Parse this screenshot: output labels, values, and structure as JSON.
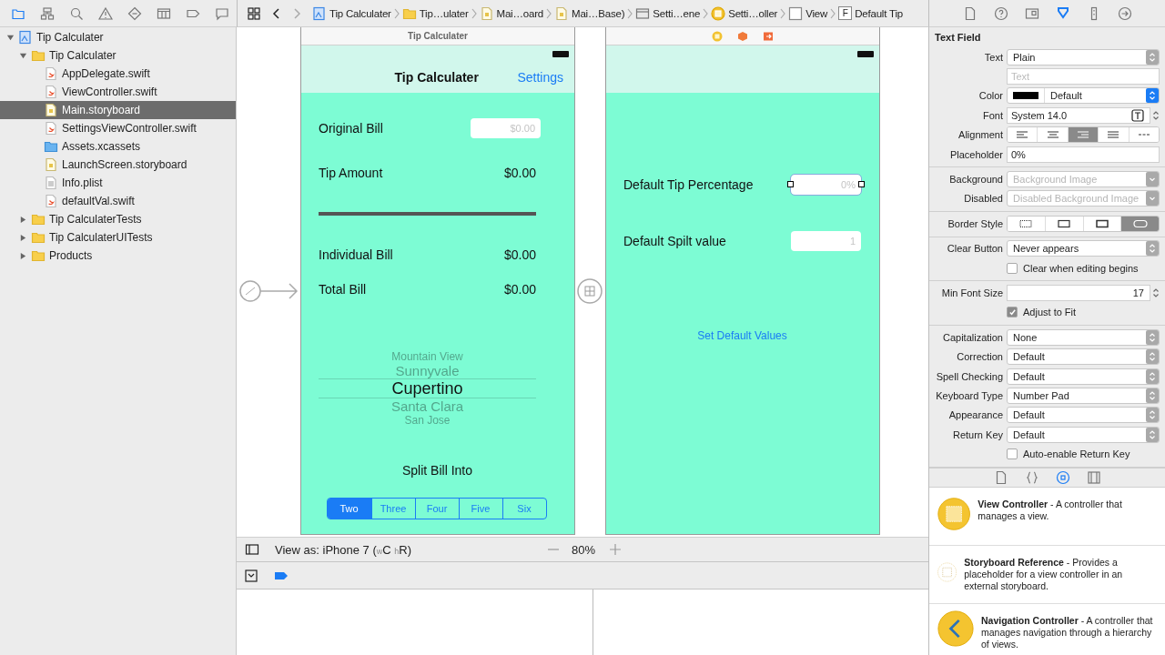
{
  "navigator_tabs": [
    {
      "selected": true
    },
    {
      "selected": false
    },
    {
      "selected": false
    },
    {
      "selected": false
    },
    {
      "selected": false
    },
    {
      "selected": false
    },
    {
      "selected": false
    },
    {
      "selected": false
    }
  ],
  "jump_bar": [
    {
      "kind": "project",
      "label": "Tip Calculater"
    },
    {
      "kind": "folder",
      "label": "Tip…ulater"
    },
    {
      "kind": "storyboard",
      "label": "Mai…oard"
    },
    {
      "kind": "storyboard",
      "label": "Mai…Base)"
    },
    {
      "kind": "scene",
      "label": "Setti…ene"
    },
    {
      "kind": "controller",
      "label": "Setti…oller"
    },
    {
      "kind": "view",
      "label": "View"
    },
    {
      "kind": "text-field",
      "badge": "F",
      "label": "Default Tip"
    }
  ],
  "inspector_tabs": [
    {
      "selected": false
    },
    {
      "selected": false
    },
    {
      "selected": false
    },
    {
      "selected": true
    },
    {
      "selected": false
    },
    {
      "selected": false
    }
  ],
  "navigator": [
    {
      "kind": "project",
      "label": "Tip Calculater",
      "expanded": true,
      "selected": false,
      "children": [
        {
          "kind": "folder",
          "label": "Tip Calculater",
          "expanded": true,
          "selected": false,
          "children": [
            {
              "kind": "swift",
              "label": "AppDelegate.swift",
              "selected": false
            },
            {
              "kind": "swift",
              "label": "ViewController.swift",
              "selected": false
            },
            {
              "kind": "storyboard",
              "label": "Main.storyboard",
              "selected": true
            },
            {
              "kind": "swift",
              "label": "SettingsViewController.swift",
              "selected": false
            },
            {
              "kind": "assets",
              "label": "Assets.xcassets",
              "selected": false
            },
            {
              "kind": "storyboard",
              "label": "LaunchScreen.storyboard",
              "selected": false
            },
            {
              "kind": "plist",
              "label": "Info.plist",
              "selected": false
            },
            {
              "kind": "swift",
              "label": "defaultVal.swift",
              "selected": false
            }
          ]
        },
        {
          "kind": "folder",
          "label": "Tip CalculaterTests",
          "expanded": false,
          "selected": false
        },
        {
          "kind": "folder",
          "label": "Tip CalculaterUITests",
          "expanded": false,
          "selected": false
        },
        {
          "kind": "folder",
          "label": "Products",
          "expanded": false,
          "selected": false
        }
      ]
    }
  ],
  "tip_scene": {
    "title": "Tip Calculater",
    "nav_title": "Tip Calculater",
    "nav_button": "Settings",
    "rows": [
      {
        "kind": "field",
        "label": "Original Bill",
        "placeholder": "$0.00"
      },
      {
        "kind": "value",
        "label": "Tip Amount",
        "value": "$0.00"
      },
      {
        "kind": "rule"
      },
      {
        "kind": "value",
        "label": "Individual Bill",
        "value": "$0.00"
      },
      {
        "kind": "value",
        "label": "Total Bill",
        "value": "$0.00"
      }
    ],
    "picker": [
      {
        "label": "Mountain View",
        "selected": false
      },
      {
        "label": "Sunnyvale",
        "selected": false
      },
      {
        "label": "Cupertino",
        "selected": true
      },
      {
        "label": "Santa Clara",
        "selected": false
      },
      {
        "label": "San Jose",
        "selected": false
      }
    ],
    "split_label": "Split Bill Into",
    "split_options": [
      {
        "label": "Two",
        "selected": true
      },
      {
        "label": "Three",
        "selected": false
      },
      {
        "label": "Four",
        "selected": false
      },
      {
        "label": "Five",
        "selected": false
      },
      {
        "label": "Six",
        "selected": false
      }
    ]
  },
  "settings_scene": {
    "rows": [
      {
        "label": "Default Tip Percentage",
        "placeholder": "0%",
        "selected": true
      },
      {
        "label": "Default Spilt value",
        "placeholder": "1",
        "selected": false
      }
    ],
    "button": "Set Default Values"
  },
  "canvas_bar": {
    "view_as": "View as: iPhone 7 ($_{w}$C $_{h}$R)",
    "zoom": "80%"
  },
  "inspector": {
    "title": "Text Field",
    "sections": [
      [
        {
          "kind": "popup",
          "label": "Text",
          "value": "Plain",
          "disabled": false
        },
        {
          "kind": "field",
          "placeholder": "Text"
        },
        {
          "kind": "color",
          "label": "Color",
          "value": "Default"
        },
        {
          "kind": "font",
          "label": "Font",
          "value": "System 14.0"
        },
        {
          "kind": "alignment",
          "label": "Alignment",
          "options": [
            {
              "selected": false
            },
            {
              "selected": false
            },
            {
              "selected": true
            },
            {
              "selected": false
            },
            {
              "selected": false
            }
          ]
        },
        {
          "kind": "field",
          "label": "Placeholder",
          "value": "0%"
        }
      ],
      [
        {
          "kind": "popup",
          "label": "Background",
          "value": "Background Image",
          "disabled": true
        },
        {
          "kind": "popup",
          "label": "Disabled",
          "value": "Disabled Background Image",
          "disabled": true
        }
      ],
      [
        {
          "kind": "border-style",
          "label": "Border Style",
          "options": [
            {
              "selected": false
            },
            {
              "selected": false
            },
            {
              "selected": false
            },
            {
              "selected": true
            }
          ]
        }
      ],
      [
        {
          "kind": "popup",
          "label": "Clear Button",
          "value": "Never appears",
          "disabled": false
        },
        {
          "kind": "checkbox",
          "label": "Clear when editing begins",
          "checked": false
        }
      ],
      [
        {
          "kind": "stepper",
          "label": "Min Font Size",
          "value": "17"
        },
        {
          "kind": "checkbox",
          "label": "Adjust to Fit",
          "checked": true
        }
      ],
      [
        {
          "kind": "popup",
          "label": "Capitalization",
          "value": "None",
          "disabled": false
        },
        {
          "kind": "popup",
          "label": "Correction",
          "value": "Default",
          "disabled": false
        },
        {
          "kind": "popup",
          "label": "Spell Checking",
          "value": "Default",
          "disabled": false
        },
        {
          "kind": "popup",
          "label": "Keyboard Type",
          "value": "Number Pad",
          "disabled": false
        },
        {
          "kind": "popup",
          "label": "Appearance",
          "value": "Default",
          "disabled": false
        },
        {
          "kind": "popup",
          "label": "Return Key",
          "value": "Default",
          "disabled": false
        },
        {
          "kind": "checkbox",
          "label": "Auto-enable Return Key",
          "checked": false
        }
      ]
    ]
  },
  "library": {
    "tabs": [
      {
        "selected": false
      },
      {
        "selected": false
      },
      {
        "selected": true
      },
      {
        "selected": false
      }
    ],
    "items": [
      {
        "kind": "view-controller",
        "text": "**View Controller** - A controller that manages a view."
      },
      {
        "kind": "storyboard-reference",
        "text": "**Storyboard Reference** - Provides a placeholder for a view controller in an external storyboard."
      },
      {
        "kind": "navigation-controller",
        "text": "**Navigation Controller** - A controller that manages navigation through a hierarchy of views."
      }
    ]
  }
}
